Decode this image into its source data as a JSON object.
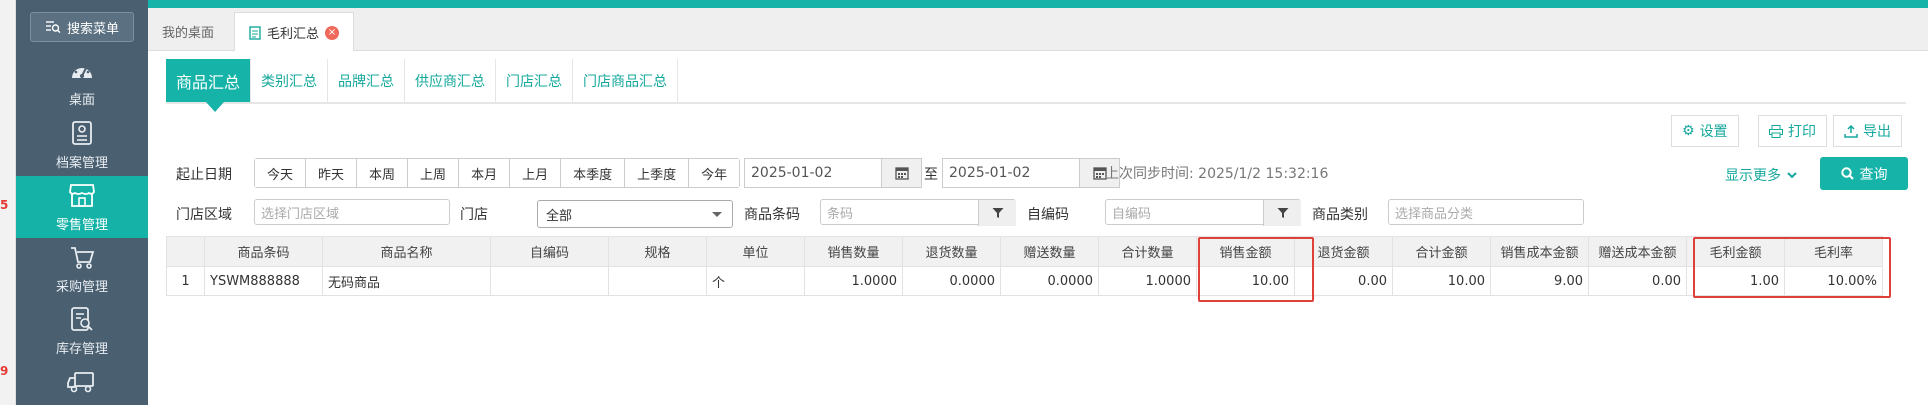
{
  "sidebar": {
    "search_label": "搜索菜单",
    "items": [
      {
        "label": "桌面",
        "icon": "dashboard-icon",
        "active": false
      },
      {
        "label": "档案管理",
        "icon": "archive-icon",
        "active": false
      },
      {
        "label": "零售管理",
        "icon": "store-icon",
        "active": true
      },
      {
        "label": "采购管理",
        "icon": "cart-icon",
        "active": false
      },
      {
        "label": "库存管理",
        "icon": "inventory-icon",
        "active": false
      },
      {
        "label": "",
        "icon": "truck-icon",
        "active": false
      }
    ],
    "edge_marks": [
      "5",
      "9"
    ]
  },
  "page_tabs": [
    {
      "label": "我的桌面",
      "active": false
    },
    {
      "label": "毛利汇总",
      "active": true
    }
  ],
  "sub_tabs": [
    {
      "label": "商品汇总",
      "active": true
    },
    {
      "label": "类别汇总",
      "active": false
    },
    {
      "label": "品牌汇总",
      "active": false
    },
    {
      "label": "供应商汇总",
      "active": false
    },
    {
      "label": "门店汇总",
      "active": false
    },
    {
      "label": "门店商品汇总",
      "active": false
    }
  ],
  "toolbar": {
    "settings_label": "设置",
    "print_label": "打印",
    "export_label": "导出"
  },
  "filters": {
    "date_label": "起止日期",
    "quick_ranges": [
      "今天",
      "昨天",
      "本周",
      "上周",
      "本月",
      "上月",
      "本季度",
      "上季度",
      "今年"
    ],
    "start_date": "2025-01-02",
    "to_label": "至",
    "end_date": "2025-01-02",
    "sync_label": "上次同步时间:",
    "sync_time": "2025/1/2 15:32:16",
    "more_label": "显示更多",
    "query_label": "查询",
    "region_label": "门店区域",
    "region_placeholder": "选择门店区域",
    "store_label": "门店",
    "store_value": "全部",
    "barcode_label": "商品条码",
    "barcode_placeholder": "条码",
    "selfcode_label": "自编码",
    "selfcode_placeholder": "自编码",
    "category_label": "商品类别",
    "category_placeholder": "选择商品分类"
  },
  "table": {
    "columns": [
      "",
      "商品条码",
      "商品名称",
      "自编码",
      "规格",
      "单位",
      "销售数量",
      "退货数量",
      "赠送数量",
      "合计数量",
      "销售金额",
      "退货金额",
      "合计金额",
      "销售成本金额",
      "赠送成本金额",
      "毛利金额",
      "毛利率"
    ],
    "rows": [
      [
        "1",
        "YSWM888888",
        "无码商品",
        "",
        "",
        "个",
        "1.0000",
        "0.0000",
        "0.0000",
        "1.0000",
        "10.00",
        "0.00",
        "10.00",
        "9.00",
        "0.00",
        "1.00",
        "10.00%"
      ]
    ]
  },
  "colors": {
    "accent": "#16b4a8",
    "sidebar_bg": "#4a5f70",
    "highlight": "#e0403a"
  }
}
